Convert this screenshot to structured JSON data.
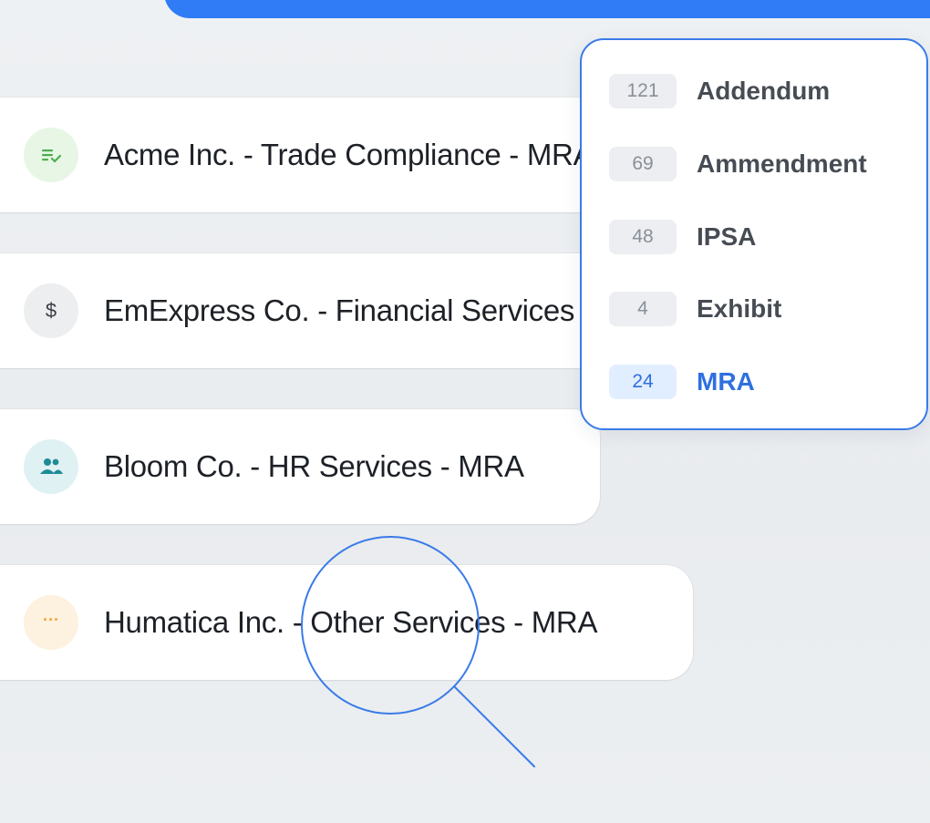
{
  "header_bar": {
    "color": "#2f7cf6"
  },
  "documents": [
    {
      "icon": "checklist-icon",
      "icon_color": "#4caf50",
      "label": "Acme Inc. - Trade Compliance - MRA"
    },
    {
      "icon": "dollar-icon",
      "icon_glyph": "$",
      "label": "EmExpress Co. - Financial Services - MRA"
    },
    {
      "icon": "people-icon",
      "icon_color": "#1e8c96",
      "label": "Bloom Co. - HR Services - MRA"
    },
    {
      "icon": "more-dots-icon",
      "icon_glyph": "···",
      "icon_color": "#f2a33a",
      "label": "Humatica Inc. - Other Services - MRA"
    }
  ],
  "type_filter": {
    "options": [
      {
        "count": "121",
        "label": "Addendum"
      },
      {
        "count": "69",
        "label": "Ammendment"
      },
      {
        "count": "48",
        "label": "IPSA"
      },
      {
        "count": "4",
        "label": "Exhibit"
      },
      {
        "count": "24",
        "label": "MRA",
        "selected": true
      }
    ],
    "accent": "#2f6fe0"
  },
  "magnifier": {
    "icon": "magnifier-icon",
    "color": "#3a7be8"
  }
}
